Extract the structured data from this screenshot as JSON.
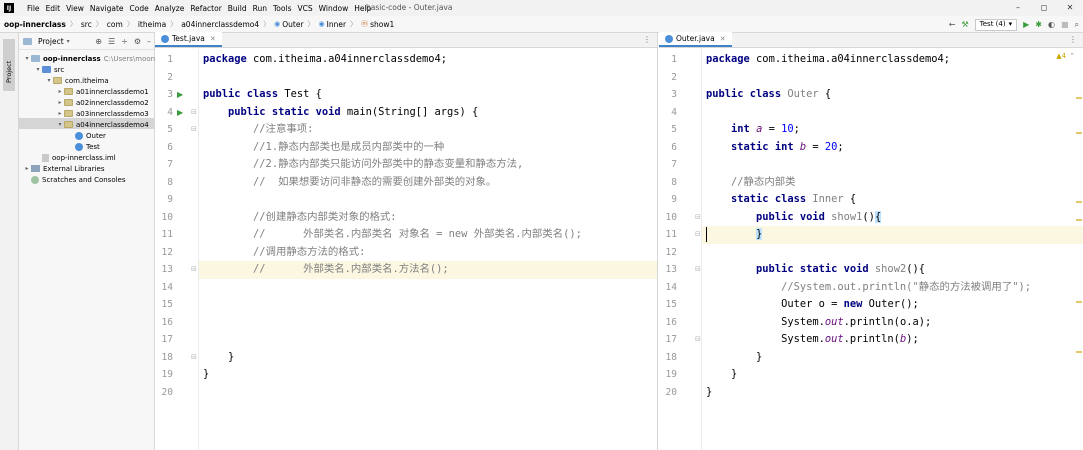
{
  "menubar": {
    "logo": "IJ",
    "items": [
      "File",
      "Edit",
      "View",
      "Navigate",
      "Code",
      "Analyze",
      "Refactor",
      "Build",
      "Run",
      "Tools",
      "VCS",
      "Window",
      "Help"
    ],
    "window_title": "basic-code - Outer.java",
    "controls": [
      "–",
      "◻",
      "✕"
    ]
  },
  "navbar": {
    "breadcrumb": [
      "oop-innerclass",
      "src",
      "com",
      "itheima",
      "a04innerclassdemo4",
      "Outer",
      "Inner",
      "show1"
    ],
    "run_config": "Test (4)"
  },
  "stripe": {
    "project_label": "Project"
  },
  "project": {
    "title": "Project",
    "tree": [
      {
        "label": "oop-innerclass",
        "sub": "C:\\Users\\moon\\Id",
        "level": 0,
        "icon": "folder",
        "bold": true,
        "arrow": "open"
      },
      {
        "label": "src",
        "sub": "",
        "level": 1,
        "icon": "src",
        "arrow": "open"
      },
      {
        "label": "com.itheima",
        "sub": "",
        "level": 2,
        "icon": "pkg",
        "arrow": "open"
      },
      {
        "label": "a01innerclassdemo1",
        "sub": "",
        "level": 3,
        "icon": "pkg",
        "arrow": "closed"
      },
      {
        "label": "a02innerclassdemo2",
        "sub": "",
        "level": 3,
        "icon": "pkg",
        "arrow": "closed"
      },
      {
        "label": "a03innerclassdemo3",
        "sub": "",
        "level": 3,
        "icon": "pkg",
        "arrow": "closed"
      },
      {
        "label": "a04innerclassdemo4",
        "sub": "",
        "level": 3,
        "icon": "pkg",
        "arrow": "open",
        "selected": true
      },
      {
        "label": "Outer",
        "sub": "",
        "level": 4,
        "icon": "class",
        "arrow": ""
      },
      {
        "label": "Test",
        "sub": "",
        "level": 4,
        "icon": "class",
        "arrow": ""
      },
      {
        "label": "oop-innerclass.iml",
        "sub": "",
        "level": 1,
        "icon": "file",
        "arrow": ""
      },
      {
        "label": "External Libraries",
        "sub": "",
        "level": 0,
        "icon": "lib",
        "arrow": "closed"
      },
      {
        "label": "Scratches and Consoles",
        "sub": "",
        "level": 0,
        "icon": "scratch",
        "arrow": ""
      }
    ]
  },
  "left_editor": {
    "tab": "Test.java",
    "current_line": 13,
    "run_markers": [
      3,
      4
    ],
    "lines": [
      [
        [
          "kw",
          "package"
        ],
        [
          "pl",
          " com.itheima.a04innerclassdemo4;"
        ]
      ],
      [],
      [
        [
          "kw",
          "public class"
        ],
        [
          "pl",
          " Test {"
        ]
      ],
      [
        [
          "pl",
          "    "
        ],
        [
          "kw",
          "public static void"
        ],
        [
          "pl",
          " main(String[] args) {"
        ]
      ],
      [
        [
          "cm",
          "        //注意事项:"
        ]
      ],
      [
        [
          "cm",
          "        //1.静态内部类也是成员内部类中的一种"
        ]
      ],
      [
        [
          "cm",
          "        //2.静态内部类只能访问外部类中的静态变量和静态方法,"
        ]
      ],
      [
        [
          "cm",
          "        //  如果想要访问非静态的需要创建外部类的对象。"
        ]
      ],
      [],
      [
        [
          "cm",
          "        //创建静态内部类对象的格式:"
        ]
      ],
      [
        [
          "cm",
          "        //      外部类名.内部类名 对象名 = new 外部类名.内部类名();"
        ]
      ],
      [
        [
          "cm",
          "        //调用静态方法的格式:"
        ]
      ],
      [
        [
          "cm",
          "        //      外部类名.内部类名.方法名();"
        ]
      ],
      [],
      [],
      [],
      [],
      [
        [
          "pl",
          "    }"
        ]
      ],
      [
        [
          "pl",
          "}"
        ]
      ],
      []
    ]
  },
  "right_editor": {
    "tab": "Outer.java",
    "current_line": 11,
    "warning_badge": "▲4",
    "lines": [
      [
        [
          "kw",
          "package"
        ],
        [
          "pl",
          " com.itheima.a04innerclassdemo4;"
        ]
      ],
      [],
      [
        [
          "kw",
          "public class"
        ],
        [
          "pl",
          " "
        ],
        [
          "cls",
          "Outer"
        ],
        [
          "pl",
          " {"
        ]
      ],
      [],
      [
        [
          "pl",
          "    "
        ],
        [
          "kw",
          "int"
        ],
        [
          "pl",
          " "
        ],
        [
          "id",
          "a"
        ],
        [
          "pl",
          " = "
        ],
        [
          "num",
          "10"
        ],
        [
          "pl",
          ";"
        ]
      ],
      [
        [
          "pl",
          "    "
        ],
        [
          "kw",
          "static int"
        ],
        [
          "pl",
          " "
        ],
        [
          "id",
          "b"
        ],
        [
          "pl",
          " = "
        ],
        [
          "num",
          "20"
        ],
        [
          "pl",
          ";"
        ]
      ],
      [],
      [
        [
          "cm",
          "    //静态内部类"
        ]
      ],
      [
        [
          "pl",
          "    "
        ],
        [
          "kw",
          "static class"
        ],
        [
          "pl",
          " "
        ],
        [
          "cls",
          "Inner"
        ],
        [
          "pl",
          " {"
        ]
      ],
      [
        [
          "pl",
          "        "
        ],
        [
          "kw",
          "public void"
        ],
        [
          "pl",
          " "
        ],
        [
          "fn",
          "show1"
        ],
        [
          "pl",
          "()"
        ],
        [
          "brace",
          "{"
        ]
      ],
      [
        [
          "pl",
          "        "
        ],
        [
          "brace",
          "}"
        ]
      ],
      [],
      [
        [
          "pl",
          "        "
        ],
        [
          "kw",
          "public static void"
        ],
        [
          "pl",
          " "
        ],
        [
          "fn",
          "show2"
        ],
        [
          "pl",
          "(){"
        ]
      ],
      [
        [
          "cm",
          "            //System.out.println(\"静态的方法被调用了\");"
        ]
      ],
      [
        [
          "pl",
          "            Outer o = "
        ],
        [
          "kw",
          "new"
        ],
        [
          "pl",
          " Outer();"
        ]
      ],
      [
        [
          "pl",
          "            System."
        ],
        [
          "id",
          "out"
        ],
        [
          "pl",
          ".println(o.a);"
        ]
      ],
      [
        [
          "pl",
          "            System."
        ],
        [
          "id",
          "out"
        ],
        [
          "pl",
          ".println("
        ],
        [
          "id",
          "b"
        ],
        [
          "pl",
          ");"
        ]
      ],
      [
        [
          "pl",
          "        }"
        ]
      ],
      [
        [
          "pl",
          "    }"
        ]
      ],
      [
        [
          "pl",
          "}"
        ]
      ]
    ]
  }
}
